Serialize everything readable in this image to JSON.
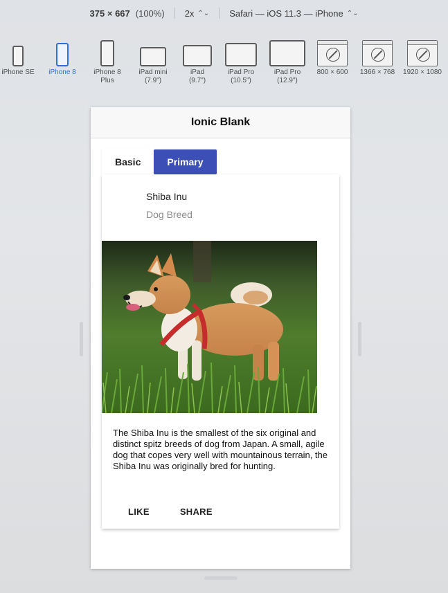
{
  "toolbar": {
    "width": "375",
    "times": "×",
    "height": "667",
    "zoom_percent": "(100%)",
    "scale": "2x",
    "user_agent": "Safari — iOS 11.3 — iPhone"
  },
  "devices": [
    {
      "label": "iPhone SE",
      "icon": "phone-icon",
      "active": false
    },
    {
      "label": "iPhone 8",
      "icon": "phone-icon",
      "active": true
    },
    {
      "label": "iPhone 8 Plus",
      "icon": "phone-icon",
      "active": false
    },
    {
      "label": "iPad mini (7.9\")",
      "icon": "tablet-icon",
      "active": false
    },
    {
      "label": "iPad (9.7\")",
      "icon": "tablet-icon",
      "active": false
    },
    {
      "label": "iPad Pro (10.5\")",
      "icon": "tablet-icon",
      "active": false
    },
    {
      "label": "iPad Pro (12.9\")",
      "icon": "tablet-icon",
      "active": false
    },
    {
      "label": "800 × 600",
      "icon": "safari-window-icon",
      "active": false
    },
    {
      "label": "1366 × 768",
      "icon": "safari-window-icon",
      "active": false
    },
    {
      "label": "1920 × 1080",
      "icon": "safari-window-icon",
      "active": false
    }
  ],
  "app": {
    "title": "Ionic Blank",
    "segments": [
      {
        "label": "Basic",
        "selected": false
      },
      {
        "label": "Primary",
        "selected": true
      }
    ],
    "card": {
      "title": "Shiba Inu",
      "subtitle": "Dog Breed",
      "description": "The Shiba Inu is the smallest of the six original and distinct spitz breeds of dog from Japan. A small, agile dog that copes very well with mountainous terrain, the Shiba Inu was originally bred for hunting.",
      "actions": [
        "LIKE",
        "SHARE"
      ]
    }
  },
  "colors": {
    "accent": "#2a6fe0",
    "primary_segment": "#3b4fb7"
  }
}
